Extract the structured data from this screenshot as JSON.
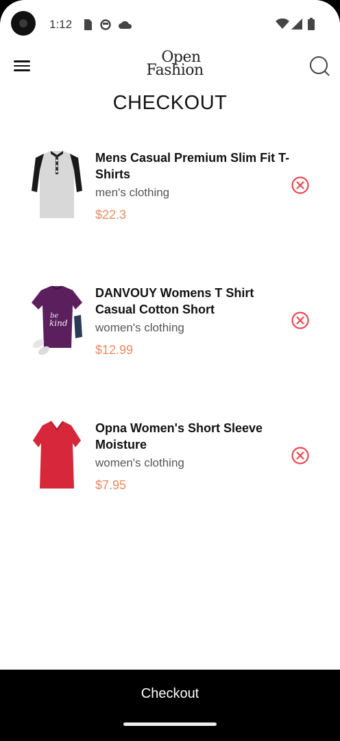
{
  "status": {
    "time": "1:12"
  },
  "header": {
    "logo_line1": "Open",
    "logo_line2": "Fashion"
  },
  "page": {
    "title": "CHECKOUT"
  },
  "items": [
    {
      "name": "Mens Casual Premium Slim Fit T-Shirts",
      "category": "men's clothing",
      "price": "$22.3"
    },
    {
      "name": "DANVOUY Womens T Shirt Casual Cotton Short",
      "category": "women's clothing",
      "price": "$12.99"
    },
    {
      "name": "Opna Women's Short Sleeve Moisture",
      "category": "women's clothing",
      "price": "$7.95"
    }
  ],
  "footer": {
    "checkout_label": "Checkout"
  },
  "colors": {
    "price": "#e88a62",
    "remove": "#e8474f",
    "footer_bg": "#000000"
  }
}
